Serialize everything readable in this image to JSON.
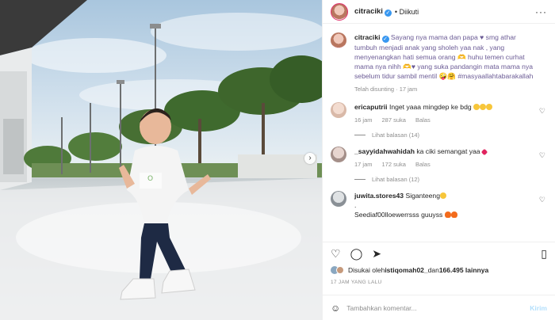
{
  "post": {
    "username": "citraciki",
    "follow_status": "Diikuti",
    "caption": "Sayang nya mama dan papa ♥ smg athar tumbuh menjadi anak yang sholeh yaa nak , yang menyenangkan hati semua orang 🫶 huhu temen curhat mama nya nihh 🫶♥ yang suka pandangin mata mama nya sebelum tidur sambil mentil 🤪🤗",
    "hashtag": "#masyaallahtabarakallah",
    "edited": "Telah disunting · 17 jam"
  },
  "comments": [
    {
      "user": "ericaputrii",
      "text": "Inget yaaa mingdep ke bdg",
      "time": "16 jam",
      "likes": "287 suka",
      "reply": "Balas",
      "view_replies": "Lihat balasan (14)"
    },
    {
      "user": "_sayyidahwahidah",
      "text": "ka ciki semangat yaa",
      "time": "17 jam",
      "likes": "172 suka",
      "reply": "Balas",
      "view_replies": "Lihat balasan (12)"
    },
    {
      "user": "juwita.stores43",
      "text": "Siganteeng",
      "line2": ".",
      "line3": "Seediaf00lloewerrsss guuyss"
    }
  ],
  "likes_line": {
    "prefix": "Disukai oleh ",
    "user": "istiqomah02_",
    "mid": " dan ",
    "count": "166.495 lainnya"
  },
  "posted": "17 JAM YANG LALU",
  "compose": {
    "placeholder": "Tambahkan komentar...",
    "send": "Kirim"
  },
  "icons": {
    "like": "heart-icon",
    "comment": "comment-icon",
    "share": "share-icon",
    "save": "bookmark-icon"
  },
  "colors": {
    "link": "#6b5b95",
    "verified": "#3897f0",
    "send": "#b2dffc"
  }
}
